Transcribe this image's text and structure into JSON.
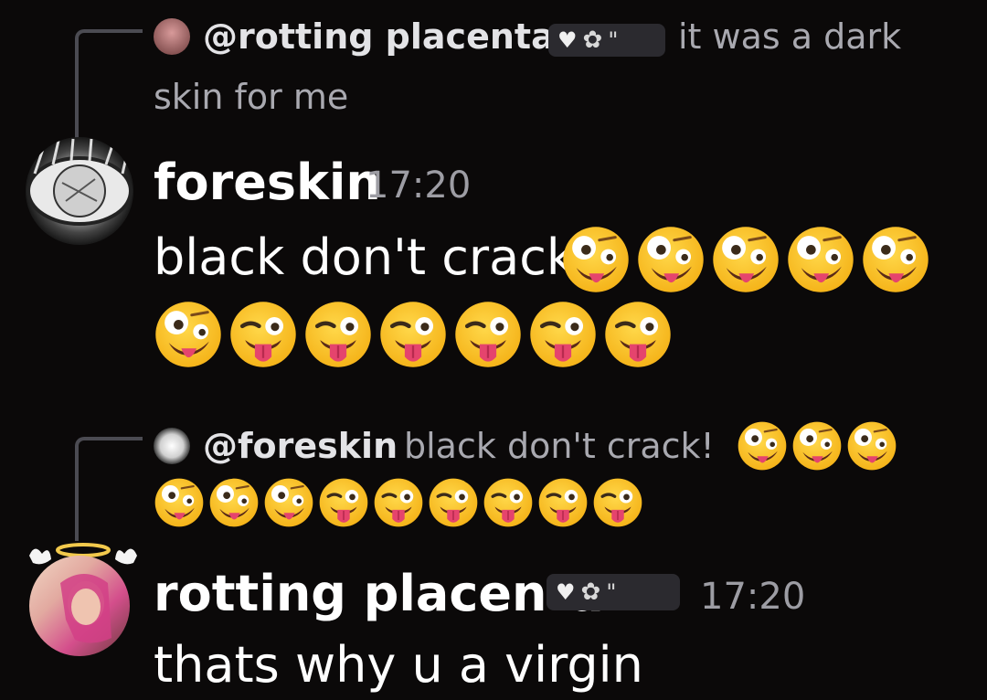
{
  "messages": [
    {
      "reply": {
        "username": "@rotting placenta",
        "text_line1": "it was a dark",
        "text_line2": "skin for me",
        "badge": {
          "heart": "♥",
          "flower": "✿",
          "quote": "\""
        }
      },
      "author": "foreskin",
      "time": "17:20",
      "text": "black don't crack!",
      "emoji": {
        "zany_count": 6,
        "wink_tongue_count": 6
      }
    },
    {
      "reply": {
        "username": "@foreskin",
        "text": "black don't crack!",
        "emoji": {
          "zany_count": 6,
          "wink_tongue_count": 6
        }
      },
      "author": "rotting placenta",
      "time": "17:20",
      "text": "thats why u a virgin",
      "badge": {
        "heart": "♥",
        "flower": "✿",
        "quote": "\""
      }
    }
  ],
  "icons": {
    "zany": "zany-face-emoji",
    "wink_tongue": "winking-tongue-emoji",
    "halo": "halo-decoration",
    "heart": "heart-icon"
  },
  "colors": {
    "background": "#0b0909",
    "reply_line": "#4b4b52",
    "muted_text": "#a9a9b0",
    "timestamp": "#9d9da4",
    "emoji_yellow": "#fbc02d"
  }
}
